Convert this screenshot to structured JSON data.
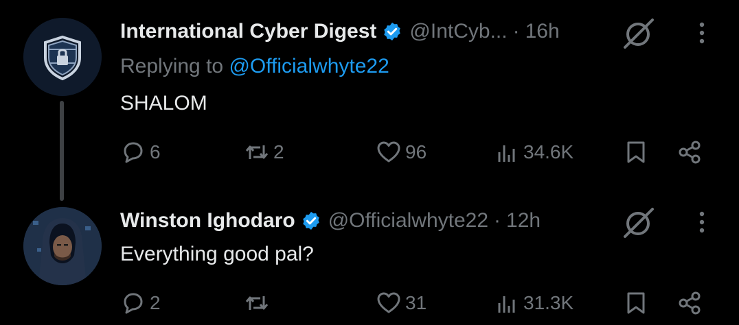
{
  "tweets": [
    {
      "author": "International Cyber Digest",
      "handle": "@IntCyb...",
      "time": "16h",
      "replying_prefix": "Replying to ",
      "replying_handle": "@Officialwhyte22",
      "text": "SHALOM",
      "replies": "6",
      "reposts": "2",
      "likes": "96",
      "views": "34.6K",
      "avatar": "shield-lock-logo"
    },
    {
      "author": "Winston Ighodaro",
      "handle": "@Officialwhyte22",
      "time": "12h",
      "text": "Everything good pal?",
      "replies": "2",
      "reposts": "",
      "likes": "31",
      "views": "31.3K",
      "avatar": "hooded-figure-portrait"
    }
  ],
  "separator": "·",
  "icons": [
    "verified-badge-icon",
    "grok-icon",
    "more-icon",
    "reply-icon",
    "repost-icon",
    "like-icon",
    "views-icon",
    "bookmark-icon",
    "share-icon"
  ],
  "colors": {
    "background": "#000000",
    "text": "#e7e9ea",
    "muted": "#71767b",
    "accent": "#1d9bf0",
    "thread_line": "#3e4144"
  }
}
